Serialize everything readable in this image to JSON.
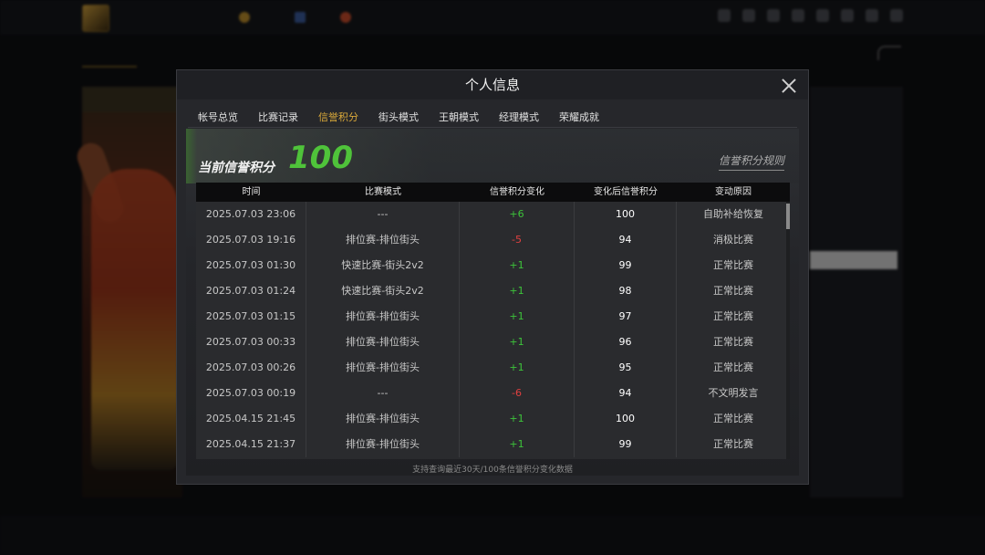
{
  "modal": {
    "title": "个人信息",
    "tabs": [
      {
        "label": "帐号总览",
        "active": false
      },
      {
        "label": "比赛记录",
        "active": false
      },
      {
        "label": "信誉积分",
        "active": true
      },
      {
        "label": "街头模式",
        "active": false
      },
      {
        "label": "王朝模式",
        "active": false
      },
      {
        "label": "经理模式",
        "active": false
      },
      {
        "label": "荣耀成就",
        "active": false
      }
    ],
    "score_label": "当前信誉积分",
    "score_value": "100",
    "rules_link": "信誉积分规则",
    "table": {
      "columns": [
        "时间",
        "比赛模式",
        "信誉积分变化",
        "变化后信誉积分",
        "变动原因"
      ],
      "rows": [
        {
          "time": "2025.07.03  23:06",
          "mode": "---",
          "change": "+6",
          "after": "100",
          "reason": "自助补给恢复"
        },
        {
          "time": "2025.07.03  19:16",
          "mode": "排位赛-排位街头",
          "change": "-5",
          "after": "94",
          "reason": "消极比赛"
        },
        {
          "time": "2025.07.03  01:30",
          "mode": "快速比赛-街头2v2",
          "change": "+1",
          "after": "99",
          "reason": "正常比赛"
        },
        {
          "time": "2025.07.03  01:24",
          "mode": "快速比赛-街头2v2",
          "change": "+1",
          "after": "98",
          "reason": "正常比赛"
        },
        {
          "time": "2025.07.03  01:15",
          "mode": "排位赛-排位街头",
          "change": "+1",
          "after": "97",
          "reason": "正常比赛"
        },
        {
          "time": "2025.07.03  00:33",
          "mode": "排位赛-排位街头",
          "change": "+1",
          "after": "96",
          "reason": "正常比赛"
        },
        {
          "time": "2025.07.03  00:26",
          "mode": "排位赛-排位街头",
          "change": "+1",
          "after": "95",
          "reason": "正常比赛"
        },
        {
          "time": "2025.07.03  00:19",
          "mode": "---",
          "change": "-6",
          "after": "94",
          "reason": "不文明发言"
        },
        {
          "time": "2025.04.15  21:45",
          "mode": "排位赛-排位街头",
          "change": "+1",
          "after": "100",
          "reason": "正常比赛"
        },
        {
          "time": "2025.04.15  21:37",
          "mode": "排位赛-排位街头",
          "change": "+1",
          "after": "99",
          "reason": "正常比赛"
        }
      ]
    },
    "footnote": "支持查询最近30天/100条信誉积分变化数据"
  },
  "colors": {
    "accent": "#d9a83a",
    "score": "#4fc33a",
    "positive": "#3dc43a",
    "negative": "#e04040"
  }
}
